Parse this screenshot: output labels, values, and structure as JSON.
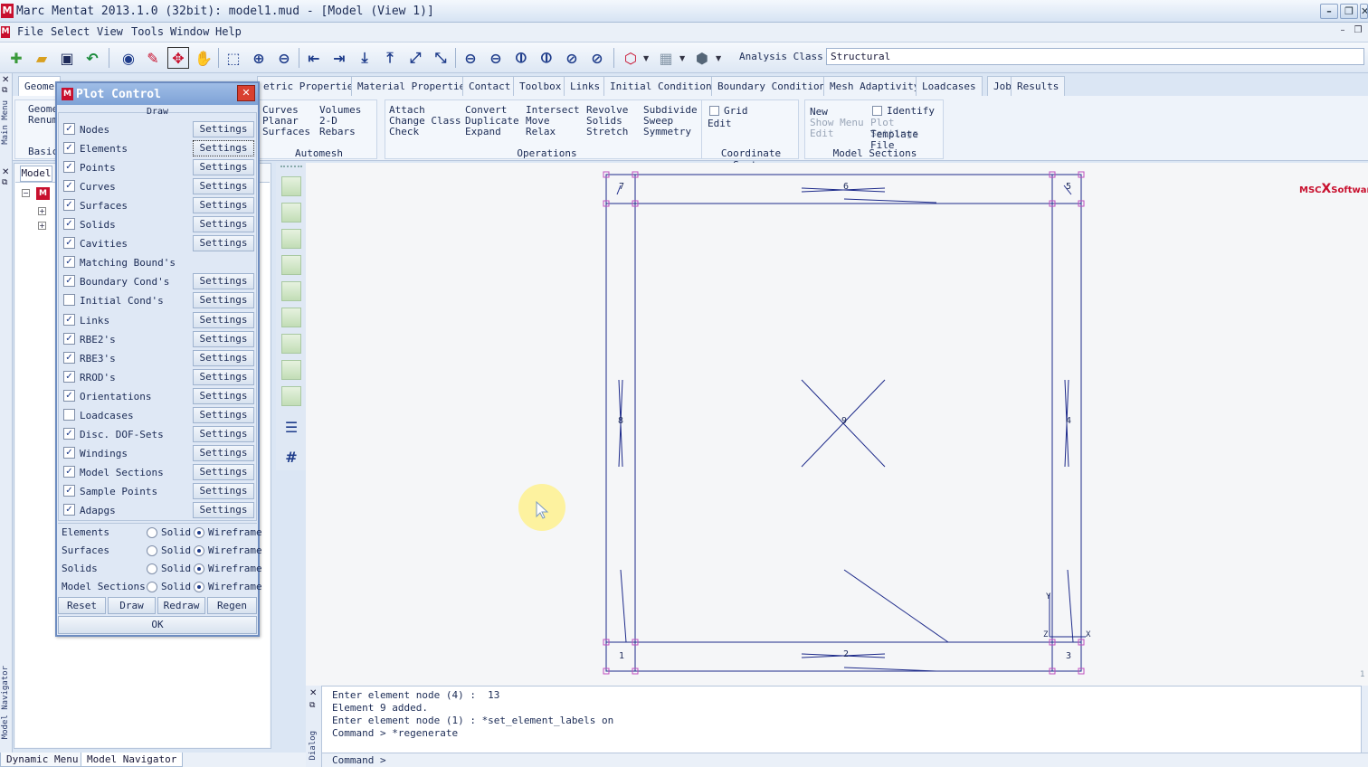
{
  "window": {
    "title": "Marc Mentat 2013.1.0 (32bit): model1.mud - [Model (View 1)]",
    "app_icon": "M",
    "btn_min": "–",
    "btn_max": "❐",
    "btn_close": "✕"
  },
  "menu": {
    "items": [
      "File",
      "Select",
      "View",
      "Tools",
      "Window",
      "Help"
    ]
  },
  "toolbar": {
    "analysis_class_label": "Analysis Class",
    "analysis_class_value": "Structural"
  },
  "ribbon": {
    "tabs": [
      "Geome",
      "etric Properties",
      "Material Properties",
      "Contact",
      "Toolbox",
      "Links",
      "Initial Conditions",
      "Boundary Conditions",
      "Mesh Adaptivity",
      "Loadcases",
      "Jobs",
      "Results"
    ],
    "left_stub": {
      "line1": "Geome",
      "line2": "Renum",
      "label": "Basic"
    },
    "automesh": {
      "col1": [
        "Curves",
        "Planar",
        "Surfaces"
      ],
      "col2": [
        "Volumes",
        "2-D Rebars"
      ],
      "label": "Automesh"
    },
    "operations": {
      "col1": [
        "Attach",
        "Change Class",
        "Check"
      ],
      "col2": [
        "Convert",
        "Duplicate",
        "Expand"
      ],
      "col3": [
        "Intersect",
        "Move",
        "Relax"
      ],
      "col4": [
        "Revolve",
        "Solids",
        "Stretch"
      ],
      "col5": [
        "Subdivide",
        "Sweep",
        "Symmetry"
      ],
      "label": "Operations"
    },
    "coord_system": {
      "grid": "Grid",
      "edit": "Edit",
      "label": "Coordinate System"
    },
    "model_sections": {
      "col1": [
        "New",
        "Show Menu",
        "Edit"
      ],
      "identify": "Identify",
      "plot_settings": "Plot Settings",
      "template_file": "Template File",
      "label": "Model Sections"
    }
  },
  "sidebars": {
    "main_menu": "Main Menu",
    "model_navigator": "Model Navigator",
    "dialog": "Dialog",
    "model_tab": "Model"
  },
  "bottom_tabs": [
    "Dynamic Menu",
    "Model Navigator"
  ],
  "plot_control": {
    "title": "Plot Control",
    "icon": "M",
    "close": "✕",
    "draw_label": "Draw",
    "rows": [
      {
        "label": "Nodes",
        "checked": true,
        "settings": "Settings"
      },
      {
        "label": "Elements",
        "checked": true,
        "settings": "Settings"
      },
      {
        "label": "Points",
        "checked": true,
        "settings": "Settings"
      },
      {
        "label": "Curves",
        "checked": true,
        "settings": "Settings"
      },
      {
        "label": "Surfaces",
        "checked": true,
        "settings": "Settings"
      },
      {
        "label": "Solids",
        "checked": true,
        "settings": "Settings"
      },
      {
        "label": "Cavities",
        "checked": true,
        "settings": "Settings"
      },
      {
        "label": "Matching Bound's",
        "checked": true,
        "settings": ""
      },
      {
        "label": "Boundary Cond's",
        "checked": true,
        "settings": "Settings"
      },
      {
        "label": "Initial Cond's",
        "checked": false,
        "settings": "Settings"
      },
      {
        "label": "Links",
        "checked": true,
        "settings": "Settings"
      },
      {
        "label": "RBE2's",
        "checked": true,
        "settings": "Settings"
      },
      {
        "label": "RBE3's",
        "checked": true,
        "settings": "Settings"
      },
      {
        "label": "RROD's",
        "checked": true,
        "settings": "Settings"
      },
      {
        "label": "Orientations",
        "checked": true,
        "settings": "Settings"
      },
      {
        "label": "Loadcases",
        "checked": false,
        "settings": "Settings"
      },
      {
        "label": "Disc. DOF-Sets",
        "checked": true,
        "settings": "Settings"
      },
      {
        "label": "Windings",
        "checked": true,
        "settings": "Settings"
      },
      {
        "label": "Model Sections",
        "checked": true,
        "settings": "Settings"
      },
      {
        "label": "Sample Points",
        "checked": true,
        "settings": "Settings"
      },
      {
        "label": "Adapgs",
        "checked": true,
        "settings": "Settings"
      }
    ],
    "render_modes": [
      {
        "label": "Elements",
        "solid": "Solid",
        "wireframe": "Wireframe",
        "selected": "wireframe"
      },
      {
        "label": "Surfaces",
        "solid": "Solid",
        "wireframe": "Wireframe",
        "selected": "wireframe"
      },
      {
        "label": "Solids",
        "solid": "Solid",
        "wireframe": "Wireframe",
        "selected": "wireframe"
      },
      {
        "label": "Model Sections",
        "solid": "Solid",
        "wireframe": "Wireframe",
        "selected": "wireframe"
      }
    ],
    "buttons": {
      "reset": "Reset",
      "draw": "Draw",
      "redraw": "Redraw",
      "regen": "Regen",
      "ok": "OK"
    }
  },
  "viewport": {
    "logo": {
      "msc": "MSC",
      "x": "X",
      "software": "Software"
    },
    "node_labels": [
      "7",
      "6",
      "5",
      "3",
      "4",
      "9",
      "1",
      "2",
      "8"
    ],
    "axis_labels": {
      "x": "X",
      "y": "Y",
      "z": "Z"
    },
    "corner_mark": "1"
  },
  "dialog": {
    "lines": [
      "Enter element node (4) :  13",
      "Element 9 added.",
      "Enter element node (1) : *set_element_labels on",
      "Command > *regenerate"
    ],
    "command_prompt": "Command >"
  },
  "colors": {
    "accent": "#c8102e",
    "model_lines": "#1d2a8a",
    "node_markers": "#c050c0"
  }
}
